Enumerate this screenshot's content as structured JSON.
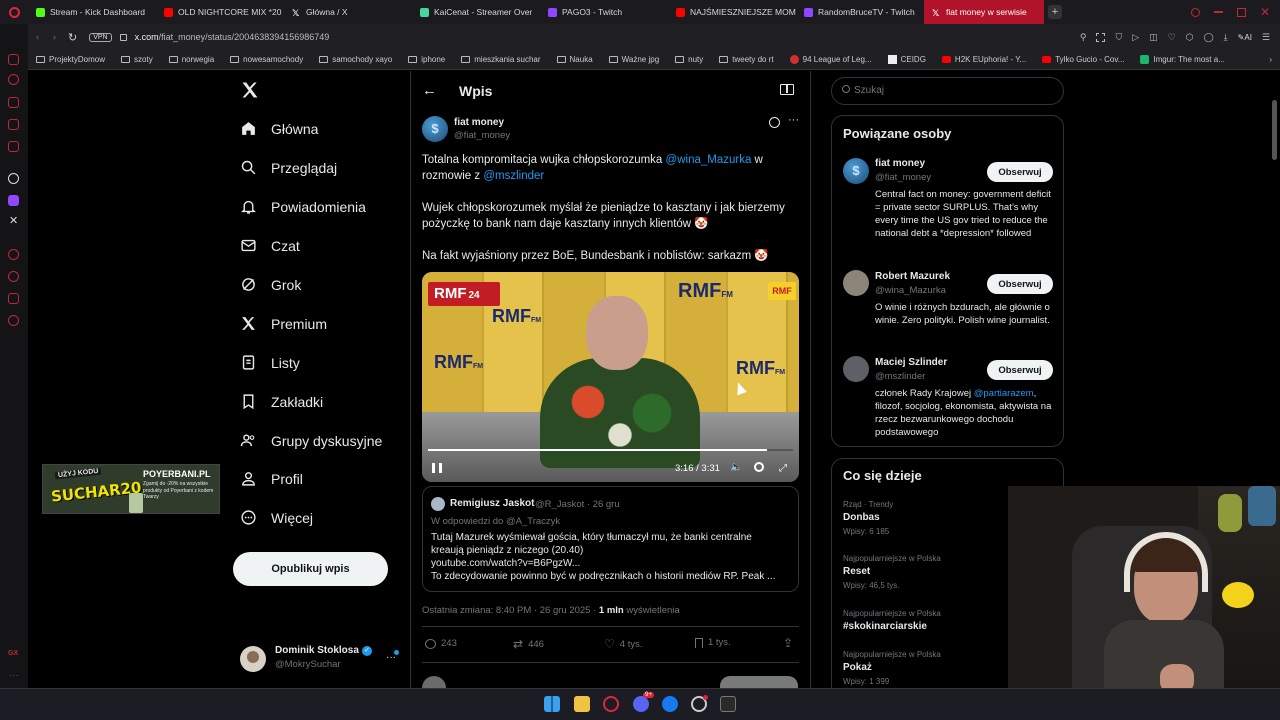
{
  "tabs": [
    {
      "label": "Stream - Kick Dashboard",
      "color": "#53fc18"
    },
    {
      "label": "OLD NIGHTCORE MIX *20",
      "color": "#ff0000"
    },
    {
      "label": "Główna / X",
      "color": "#ffffff"
    },
    {
      "label": "KaiCenat - Streamer Over",
      "color": "#4ad4a0"
    },
    {
      "label": "PAGO3 - Twitch",
      "color": "#9146ff"
    },
    {
      "label": "NAJŚMIESZNIEJSZE MOM",
      "color": "#ff0000"
    },
    {
      "label": "RandomBruceTV - Twitch",
      "color": "#9146ff"
    },
    {
      "label": "fiat money w serwisie",
      "color": "#ffffff"
    }
  ],
  "url": {
    "vpn": "VPN",
    "host": "x.com",
    "path": "/fiat_money/status/2004638394156986749",
    "ai": "AI"
  },
  "bookmarks": [
    "ProjektyDomow",
    "szoty",
    "norwegia",
    "nowesamochody",
    "samochody xayo",
    "iphone",
    "mieszkania suchar",
    "Nauka",
    "Ważne jpg",
    "nuty",
    "tweety do rt",
    "94 League of Leg...",
    "CEIDG",
    "H2K EUphoria! - Y...",
    "Tylko Gucio - Cov...",
    "Imgur: The most a..."
  ],
  "nav": {
    "items": [
      "Główna",
      "Przeglądaj",
      "Powiadomienia",
      "Czat",
      "Grok",
      "Premium",
      "Listy",
      "Zakładki",
      "Grupy dyskusyjne",
      "Profil",
      "Więcej"
    ],
    "post_button": "Opublikuj wpis"
  },
  "account": {
    "name": "Dominik Stoklosa",
    "handle": "@MokrySuchar"
  },
  "promo": {
    "code_top": "UŻYJ KODU",
    "code": "SUCHAR20",
    "brand": "POYERBANI.PL",
    "desc": "Zgarnij do -20% na wszystkie produkty od Poyerbani z kodem Twarzy"
  },
  "header": {
    "title": "Wpis"
  },
  "tweet": {
    "author": "fiat money",
    "handle": "@fiat_money",
    "p1_a": "Totalna kompromitacja wujka chłopskorozumka ",
    "p1_mention": "@wina_Mazurka",
    "p1_b": " w rozmowie z ",
    "p1_mention2": "@mszlinder",
    "p2": "Wujek chłopskorozumek myślał że pieniądze to kasztany i jak bierzemy pożyczkę to bank nam daje kasztany innych klientów 🤡",
    "p3": "Na fakt wyjaśniony przez BoE, Bundesbank i noblistów: sarkazm 🤡",
    "video": {
      "time": "3:16 / 3:31",
      "progress": 0.93,
      "logo1": "RMF",
      "logo1b": "24",
      "logo2": "RMF",
      "logo2b": "FM"
    },
    "quote": {
      "name": "Remigiusz Jaskot",
      "handle": "@R_Jaskot",
      "date": "· 26 gru",
      "reply": "W odpowiedzi do @A_Traczyk",
      "line1": "Tutaj Mazurek wyśmiewał gościa, który tłumaczył mu, że banki centralne",
      "line2": "kreaują pieniądz z niczego (20.40)",
      "line3": "youtube.com/watch?v=B6PgzW...",
      "line4": "To zdecydowanie powinno być w podręcznikach o historii mediów RP. Peak ..."
    },
    "meta_a": "Ostatnia zmiana: 8:40 PM · 26 gru 2025 · ",
    "views": "1 mln",
    "meta_b": " wyświetlenia",
    "replies": "243",
    "reposts": "446",
    "likes": "4 tys.",
    "bookmarks": "1 tys."
  },
  "search": {
    "placeholder": "Szukaj"
  },
  "related": {
    "title": "Powiązane osoby",
    "follow": "Obserwuj",
    "people": [
      {
        "name": "fiat money",
        "handle": "@fiat_money",
        "bio": "Central fact on money: government deficit = private sector SURPLUS. That’s why every time the US gov tried to reduce the national debt a *depression* followed"
      },
      {
        "name": "Robert Mazurek",
        "handle": "@wina_Mazurka",
        "bio": "O winie i różnych bzdurach, ale głównie o winie. Zero polityki. Polish wine journalist."
      },
      {
        "name": "Maciej Szlinder",
        "handle": "@mszlinder",
        "bio_a": "członek Rady Krajowej ",
        "bio_mention": "@partiarazem",
        "bio_b": ", filozof, socjolog, ekonomista, aktywista na rzecz bezwarunkowego dochodu podstawowego"
      }
    ]
  },
  "trends": {
    "title": "Co się dzieje",
    "items": [
      {
        "sub": "Rząd · Trendy",
        "name": "Donbas",
        "count": "Wpisy: 6 185"
      },
      {
        "sub": "Najpopularniejsze w Polska",
        "name": "Reset",
        "count": "Wpisy: 46,5 tys."
      },
      {
        "sub": "Najpopularniejsze w Polska",
        "name": "#skokinarciarskie",
        "count": ""
      },
      {
        "sub": "Najpopularniejsze w Polska",
        "name": "Pokaż",
        "count": "Wpisy: 1 399"
      }
    ]
  },
  "taskbar": {
    "badge": "9+"
  }
}
